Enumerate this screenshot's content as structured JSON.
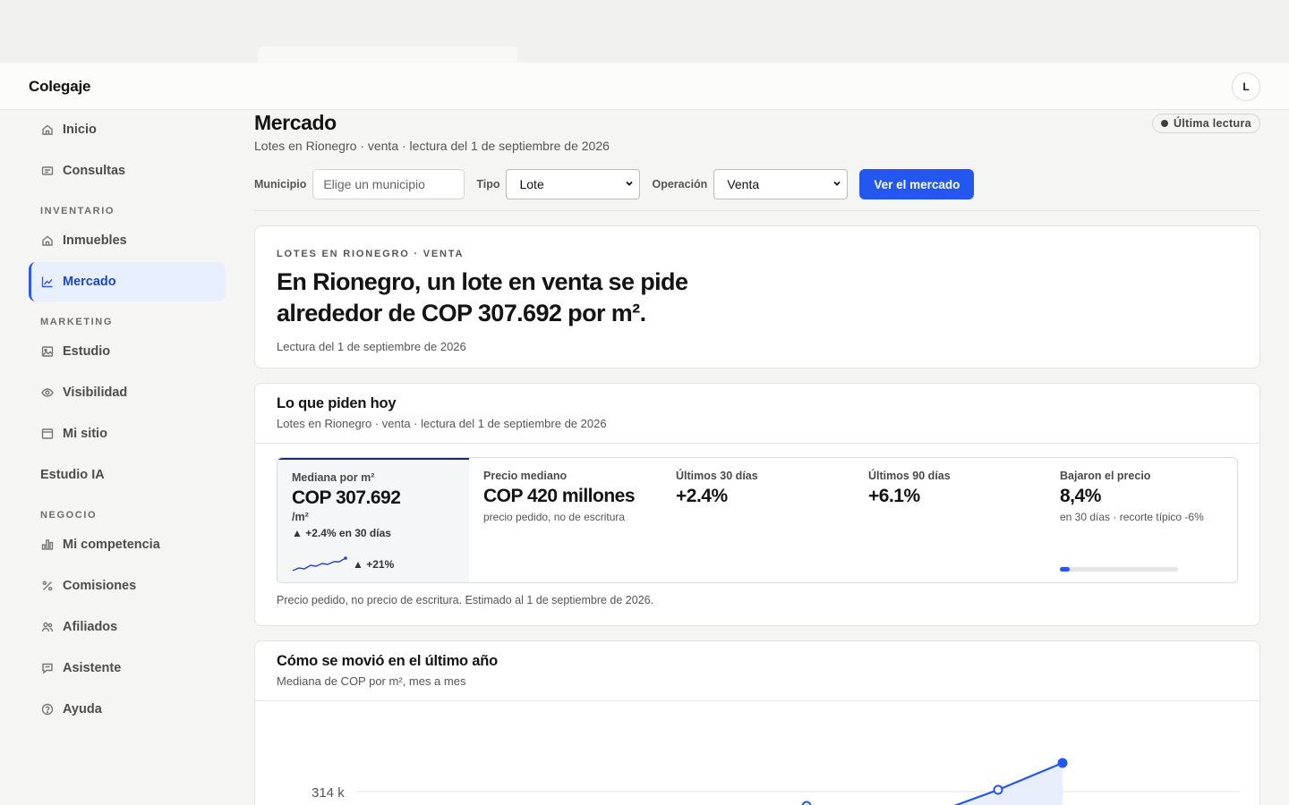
{
  "app": {
    "brand": "Colegaje",
    "avatar_initial": "L"
  },
  "sidebar": {
    "items": [
      {
        "id": "inicio",
        "label": "Inicio",
        "icon": "home-icon"
      },
      {
        "id": "consultas",
        "label": "Consultas",
        "icon": "inbox-icon"
      },
      {
        "id": "inmuebles",
        "label": "Inmuebles",
        "icon": "house-icon"
      },
      {
        "id": "mercado",
        "label": "Mercado",
        "icon": "chart-icon",
        "active": true
      },
      {
        "id": "estudio",
        "label": "Estudio",
        "icon": "image-icon"
      },
      {
        "id": "visibilidad",
        "label": "Visibilidad",
        "icon": "eye-icon"
      },
      {
        "id": "mi-sitio",
        "label": "Mi sitio",
        "icon": "browser-icon"
      },
      {
        "id": "estudio-ia",
        "label": "Estudio IA"
      },
      {
        "id": "mi-competencia",
        "label": "Mi competencia",
        "icon": "bars-icon"
      },
      {
        "id": "comisiones",
        "label": "Comisiones",
        "icon": "percent-icon"
      },
      {
        "id": "afiliados",
        "label": "Afiliados",
        "icon": "users-icon"
      },
      {
        "id": "asistente",
        "label": "Asistente",
        "icon": "chat-icon"
      },
      {
        "id": "ayuda",
        "label": "Ayuda",
        "icon": "help-icon"
      }
    ],
    "sections": {
      "inventario": "INVENTARIO",
      "marketing": "MARKETING",
      "negocio": "NEGOCIO"
    }
  },
  "page": {
    "title": "Mercado",
    "subtitle": "Lotes en Rionegro · venta · lectura del 1 de septiembre de 2026",
    "badge": "Última lectura"
  },
  "filters": {
    "municipio_label": "Municipio",
    "municipio_placeholder": "Elige un municipio",
    "tipo_label": "Tipo",
    "tipo_value": "Lote",
    "operacion_label": "Operación",
    "operacion_value": "Venta",
    "submit_label": "Ver el mercado"
  },
  "hero": {
    "kicker": "LOTES EN RIONEGRO · VENTA",
    "headline": "En Rionegro, un lote en venta se pide alrededor de COP 307.692 por m².",
    "date": "Lectura del 1 de septiembre de 2026"
  },
  "today": {
    "title": "Lo que piden hoy",
    "subtitle": "Lotes en Rionegro · venta · lectura del 1 de septiembre de 2026",
    "stats": {
      "median_m2": {
        "label": "Mediana por m²",
        "value": "COP 307.692",
        "unit": "/m²",
        "delta": "▲ +2.4% en 30 días",
        "year_delta": "▲ +21%"
      },
      "median_price": {
        "label": "Precio mediano",
        "value": "COP 420 millones",
        "note": "precio pedido, no de escritura"
      },
      "last_30": {
        "label": "Últimos 30 días",
        "value": "+2.4%"
      },
      "last_90": {
        "label": "Últimos 90 días",
        "value": "+6.1%"
      },
      "price_drops": {
        "label": "Bajaron el precio",
        "value": "8,4%",
        "note": "en 30 días · recorte típico -6%",
        "fraction": 0.084
      }
    },
    "footnote": "Precio pedido, no precio de escritura. Estimado al 1 de septiembre de 2026."
  },
  "trend": {
    "title": "Cómo se movió en el último año",
    "subtitle": "Mediana de COP por m², mes a mes",
    "y_tick_label": "314 k"
  },
  "colors": {
    "accent": "#2457f0",
    "active_bg": "#e8efff",
    "sparkline": "#2446c8"
  }
}
